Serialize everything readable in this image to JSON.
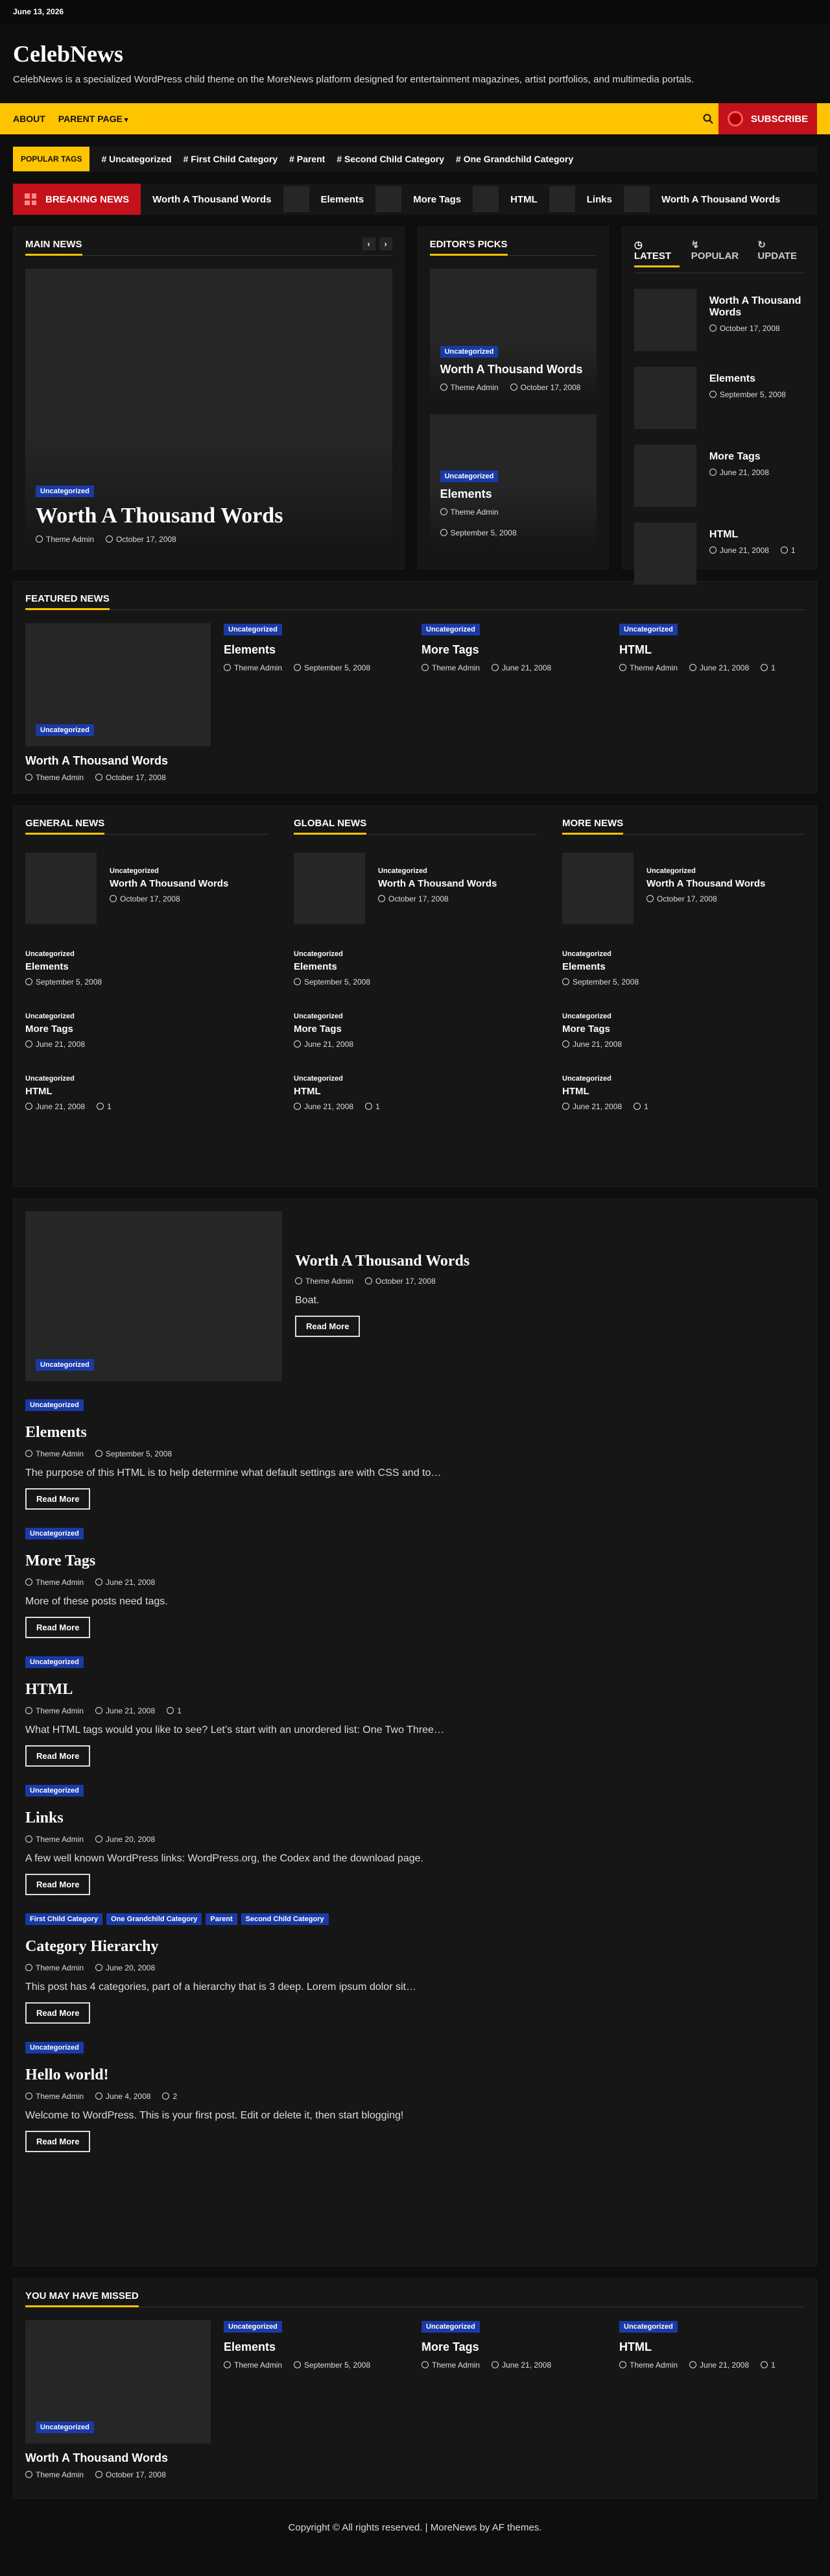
{
  "topbar": {
    "date": "June 13, 2026"
  },
  "site": {
    "title": "CelebNews",
    "description": "CelebNews is a specialized WordPress child theme on the MoreNews platform designed for entertainment magazines, artist portfolios, and multimedia portals."
  },
  "nav": {
    "about": "ABOUT",
    "parent": "PARENT PAGE",
    "subscribe": "SUBSCRIBE"
  },
  "popular_tags": {
    "label": "POPULAR TAGS",
    "tags": [
      "# Uncategorized",
      "# First Child Category",
      "# Parent",
      "# Second Child Category",
      "# One Grandchild Category"
    ]
  },
  "breaking": {
    "label": "BREAKING NEWS",
    "items": [
      "Worth A Thousand Words",
      "Elements",
      "More Tags",
      "HTML",
      "Links",
      "Worth A Thousand Words"
    ]
  },
  "main_news": {
    "title": "MAIN NEWS",
    "badge": "Uncategorized",
    "headline": "Worth A Thousand Words",
    "author": "Theme Admin",
    "date": "October 17, 2008"
  },
  "editors": {
    "title": "EDITOR'S PICKS",
    "cards": [
      {
        "badge": "Uncategorized",
        "title": "Worth A Thousand Words",
        "author": "Theme Admin",
        "date": "October 17, 2008"
      },
      {
        "badge": "Uncategorized",
        "title": "Elements",
        "author": "Theme Admin",
        "date": "September 5, 2008"
      }
    ]
  },
  "latest": {
    "tabs": [
      "LATEST",
      "POPULAR",
      "UPDATE"
    ],
    "items": [
      {
        "title": "Worth A Thousand Words",
        "date": "October 17, 2008",
        "comments": ""
      },
      {
        "title": "Elements",
        "date": "September 5, 2008",
        "comments": ""
      },
      {
        "title": "More Tags",
        "date": "June 21, 2008",
        "comments": ""
      },
      {
        "title": "HTML",
        "date": "June 21, 2008",
        "comments": "1"
      }
    ]
  },
  "featured": {
    "title": "FEATURED NEWS",
    "big": {
      "badge": "Uncategorized",
      "title": "Worth A Thousand Words",
      "author": "Theme Admin",
      "date": "October 17, 2008"
    },
    "cols": [
      {
        "badge": "Uncategorized",
        "title": "Elements",
        "author": "Theme Admin",
        "date": "September 5, 2008",
        "comments": ""
      },
      {
        "badge": "Uncategorized",
        "title": "More Tags",
        "author": "Theme Admin",
        "date": "June 21, 2008",
        "comments": ""
      },
      {
        "badge": "Uncategorized",
        "title": "HTML",
        "author": "Theme Admin",
        "date": "June 21, 2008",
        "comments": "1"
      }
    ]
  },
  "categories": [
    {
      "title": "GENERAL NEWS"
    },
    {
      "title": "GLOBAL NEWS"
    },
    {
      "title": "MORE NEWS"
    }
  ],
  "cat_items": [
    {
      "cat": "Uncategorized",
      "title": "Worth A Thousand Words",
      "date": "October 17, 2008",
      "comments": ""
    },
    {
      "cat": "Uncategorized",
      "title": "Elements",
      "date": "September 5, 2008",
      "comments": ""
    },
    {
      "cat": "Uncategorized",
      "title": "More Tags",
      "date": "June 21, 2008",
      "comments": ""
    },
    {
      "cat": "Uncategorized",
      "title": "HTML",
      "date": "June 21, 2008",
      "comments": "1"
    }
  ],
  "posts": [
    {
      "badges": [
        "Uncategorized"
      ],
      "title": "Worth A Thousand Words",
      "author": "Theme Admin",
      "date": "October 17, 2008",
      "comments": "",
      "excerpt": "Boat.",
      "btn": "Read More"
    },
    {
      "badges": [
        "Uncategorized"
      ],
      "title": "Elements",
      "author": "Theme Admin",
      "date": "September 5, 2008",
      "comments": "",
      "excerpt": "The purpose of this HTML is to help determine what default settings are with CSS and to…",
      "btn": "Read More"
    },
    {
      "badges": [
        "Uncategorized"
      ],
      "title": "More Tags",
      "author": "Theme Admin",
      "date": "June 21, 2008",
      "comments": "",
      "excerpt": "More of these posts need tags.",
      "btn": "Read More"
    },
    {
      "badges": [
        "Uncategorized"
      ],
      "title": "HTML",
      "author": "Theme Admin",
      "date": "June 21, 2008",
      "comments": "1",
      "excerpt": "What HTML tags would you like to see? Let’s start with an unordered list: One Two Three…",
      "btn": "Read More"
    },
    {
      "badges": [
        "Uncategorized"
      ],
      "title": "Links",
      "author": "Theme Admin",
      "date": "June 20, 2008",
      "comments": "",
      "excerpt": "A few well known WordPress links: WordPress.org, the Codex and the download page.",
      "btn": "Read More"
    },
    {
      "badges": [
        "First Child Category",
        "One Grandchild Category",
        "Parent",
        "Second Child Category"
      ],
      "title": "Category Hierarchy",
      "author": "Theme Admin",
      "date": "June 20, 2008",
      "comments": "",
      "excerpt": "This post has 4 categories, part of a hierarchy that is 3 deep. Lorem ipsum dolor sit…",
      "btn": "Read More"
    },
    {
      "badges": [
        "Uncategorized"
      ],
      "title": "Hello world!",
      "author": "Theme Admin",
      "date": "June 4, 2008",
      "comments": "2",
      "excerpt": "Welcome to WordPress. This is your first post. Edit or delete it, then start blogging!",
      "btn": "Read More"
    }
  ],
  "missed": {
    "title": "YOU MAY HAVE MISSED",
    "big": {
      "badge": "Uncategorized",
      "title": "Worth A Thousand Words",
      "author": "Theme Admin",
      "date": "October 17, 2008"
    },
    "cols": [
      {
        "badge": "Uncategorized",
        "title": "Elements",
        "author": "Theme Admin",
        "date": "September 5, 2008",
        "comments": ""
      },
      {
        "badge": "Uncategorized",
        "title": "More Tags",
        "author": "Theme Admin",
        "date": "June 21, 2008",
        "comments": ""
      },
      {
        "badge": "Uncategorized",
        "title": "HTML",
        "author": "Theme Admin",
        "date": "June 21, 2008",
        "comments": "1"
      }
    ]
  },
  "footer": {
    "text": "Copyright © All rights reserved. | MoreNews by AF themes."
  }
}
